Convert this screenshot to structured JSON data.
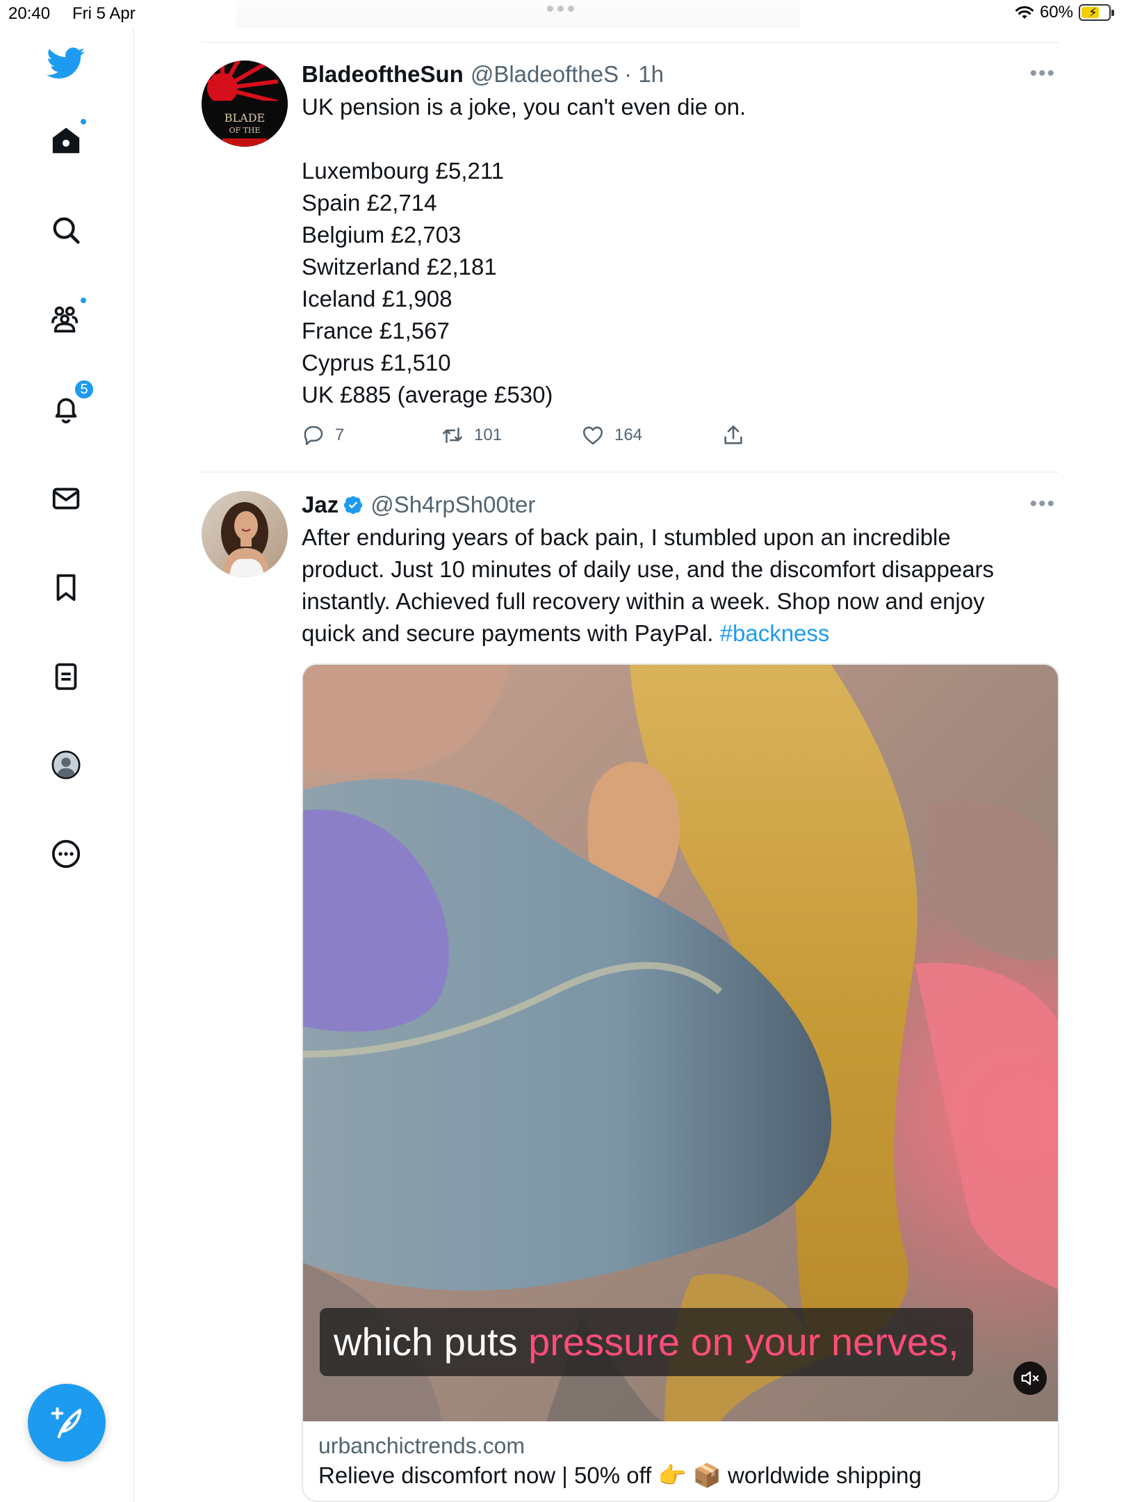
{
  "status_bar": {
    "time": "20:40",
    "date": "Fri 5 Apr",
    "battery": "60%"
  },
  "sidebar": {
    "items": [
      {
        "name": "home",
        "icon": "home-icon",
        "has_dot": true
      },
      {
        "name": "explore",
        "icon": "search-icon",
        "has_dot": false
      },
      {
        "name": "communities",
        "icon": "people-icon",
        "has_dot": true
      },
      {
        "name": "notifications",
        "icon": "bell-icon",
        "badge": "5"
      },
      {
        "name": "messages",
        "icon": "mail-icon"
      },
      {
        "name": "bookmarks",
        "icon": "bookmark-icon"
      },
      {
        "name": "lists",
        "icon": "list-icon"
      },
      {
        "name": "profile",
        "icon": "profile-icon"
      },
      {
        "name": "more",
        "icon": "more-circle-icon"
      }
    ],
    "notification_badge": "5",
    "compose_icon": "compose-icon"
  },
  "colors": {
    "accent": "#1d9bf0",
    "text": "#0f1419",
    "secondary": "#536471"
  },
  "tweets": [
    {
      "name": "BladeoftheSun",
      "handle": "@BladeoftheS",
      "time": "· 1h",
      "text_lines": [
        "UK pension is a joke, you can't even die on.",
        "",
        "Luxembourg £5,211",
        "Spain £2,714",
        "Belgium £2,703",
        "Switzerland £2,181",
        "Iceland £1,908",
        "France £1,567",
        "Cyprus £1,510",
        "UK £885 (average £530)"
      ],
      "replies": "7",
      "retweets": "101",
      "likes": "164",
      "avatar_text": [
        "BLADE",
        "OF THE"
      ]
    },
    {
      "name": "Jaz",
      "handle": "@Sh4rpSh00ter",
      "verified": true,
      "text_lines": [
        "After enduring years of back pain, I stumbled upon an incredible",
        "product. Just 10 minutes of daily use, and the discomfort disappears",
        "instantly. Achieved full recovery within a week. Shop now and enjoy",
        "quick and secure payments with PayPal. "
      ],
      "hashtag": "#backness",
      "media": {
        "caption_white": "which puts ",
        "caption_pink": "pressure on your nerves,",
        "mute_icon": "mute-icon"
      },
      "card": {
        "domain": "urbanchictrends.com",
        "title": "Relieve discomfort now | 50% off 👉 📦 worldwide shipping"
      }
    }
  ]
}
